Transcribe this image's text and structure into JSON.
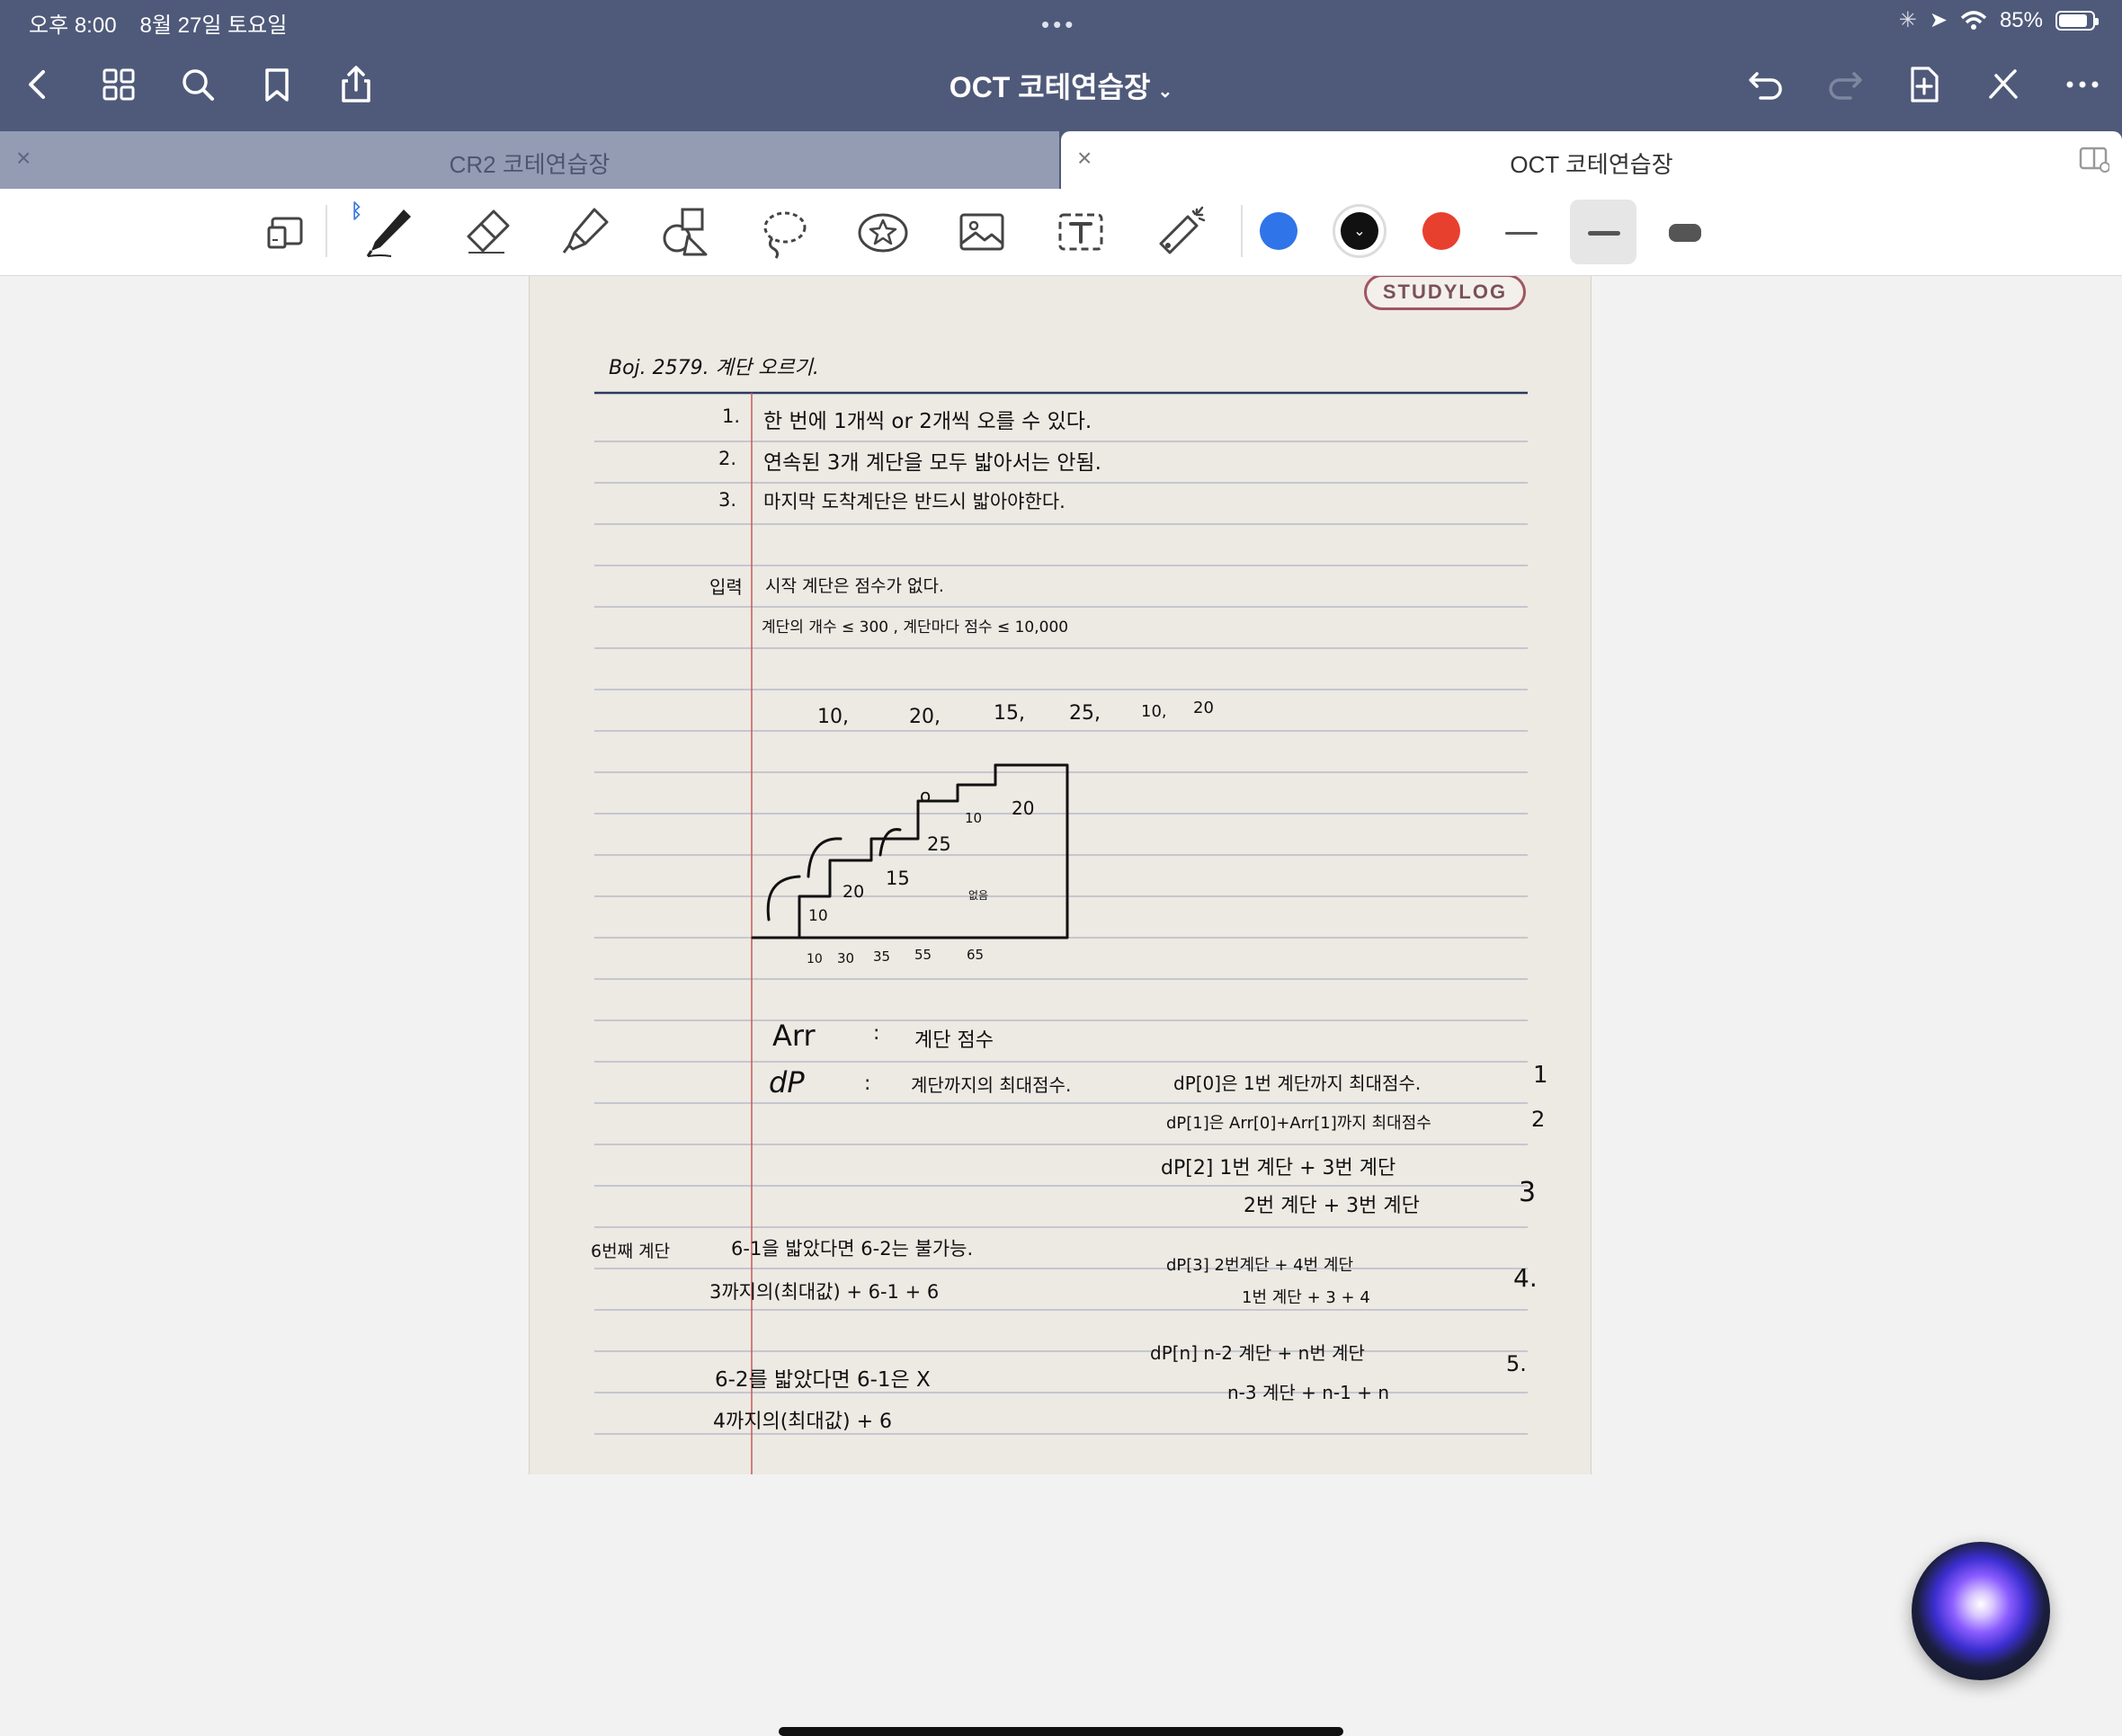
{
  "status_bar": {
    "time": "오후 8:00",
    "date": "8월 27일 토요일",
    "battery": "85%",
    "battery_level": 0.85
  },
  "nav": {
    "title": "OCT 코테연습장",
    "multitask_dots": "•••"
  },
  "tabs": [
    {
      "label": "CR2 코테연습장",
      "active": false
    },
    {
      "label": "OCT 코테연습장",
      "active": true
    }
  ],
  "toolbar": {
    "colors": [
      "#2f74e8",
      "#111111",
      "#e8402f"
    ],
    "selected_color": "#111111",
    "tools": [
      "lasso-icon",
      "pen-icon",
      "eraser-icon",
      "highlighter-icon",
      "shapes-icon",
      "lasso-select-icon",
      "sticker-icon",
      "image-icon",
      "text-icon",
      "laser-pointer-icon"
    ]
  },
  "note": {
    "logo": "STUDYLOG",
    "problem": "Boj. 2579. 계단 오르기.",
    "rules": [
      {
        "num": "1.",
        "text": "한 번에 1개씩 or 2개씩 오를 수 있다."
      },
      {
        "num": "2.",
        "text": "연속된 3개 계단을 모두 밟아서는 안됨."
      },
      {
        "num": "3.",
        "text": "마지막 도착계단은 반드시 밟아야한다."
      }
    ],
    "input_label": "입력",
    "input_line1": "시작 계단은 점수가 없다.",
    "input_line2": "계단의 개수 ≤ 300 ,   계단마다 점수 ≤ 10,000",
    "sequence": [
      "10,",
      "20,",
      "15,",
      "25,",
      "10,",
      "20"
    ],
    "stair_values": [
      "10",
      "20",
      "15",
      "25",
      "10",
      "20"
    ],
    "stair_extra": [
      "o",
      "없음"
    ],
    "cumulative": [
      "10",
      "30",
      "35",
      "55",
      "65"
    ],
    "arr_label": "Arr",
    "arr_colon": ":",
    "arr_desc": "계단 점수",
    "dp_label": "dP",
    "dp_colon": ":",
    "dp_desc": "계단까지의 최대점수.",
    "dp_cases": [
      {
        "num": "1",
        "lines": [
          "dP[0]은 1번 계단까지 최대점수."
        ]
      },
      {
        "num": "2",
        "lines": [
          "dP[1]은 Arr[0]+Arr[1]까지 최대점수"
        ]
      },
      {
        "num": "3",
        "lines": [
          "dP[2]  1번 계단 + 3번 계단",
          "2번 계단 + 3번 계단"
        ]
      },
      {
        "num": "4.",
        "lines": [
          "dP[3]  2번계단 + 4번 계단",
          "1번 계단 + 3 + 4"
        ]
      },
      {
        "num": "5.",
        "lines": [
          "dP[n]  n-2 계단 + n번 계단",
          "n-3 계단 + n-1 + n"
        ]
      }
    ],
    "sixth": {
      "label": "6번째 계단",
      "a1": "6-1을 밟았다면 6-2는 불가능.",
      "a2": "3까지의(최대값) + 6-1 + 6",
      "b1": "6-2를 밟았다면 6-1은 X",
      "b2": "4까지의(최대값) + 6"
    }
  }
}
